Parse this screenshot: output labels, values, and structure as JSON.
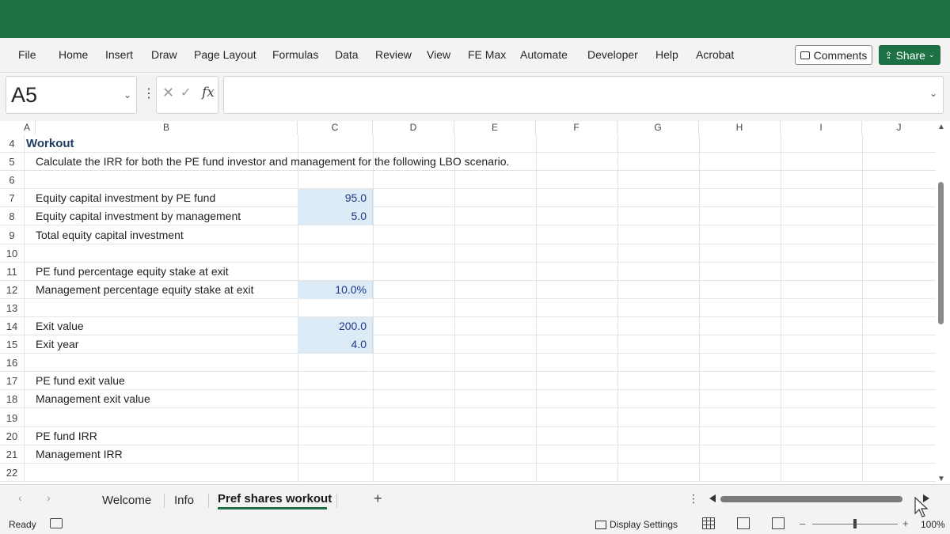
{
  "ribbon": {
    "tabs": [
      "File",
      "Home",
      "Insert",
      "Draw",
      "Page Layout",
      "Formulas",
      "Data",
      "Review",
      "View",
      "FE Max",
      "Automate",
      "Developer",
      "Help",
      "Acrobat"
    ],
    "comments_label": "Comments",
    "share_label": "Share"
  },
  "formula_bar": {
    "name_box": "A5",
    "fx_label": "fx",
    "formula": ""
  },
  "columns": [
    "A",
    "B",
    "C",
    "D",
    "E",
    "F",
    "G",
    "H",
    "I",
    "J"
  ],
  "rows": [
    {
      "num": "4",
      "a": "Workout",
      "b": "",
      "c": ""
    },
    {
      "num": "5",
      "a": "",
      "b": "Calculate the IRR for both the PE fund investor and management for the following LBO scenario.",
      "c": ""
    },
    {
      "num": "6",
      "a": "",
      "b": "",
      "c": ""
    },
    {
      "num": "7",
      "a": "",
      "b": "Equity capital investment by PE fund",
      "c": "95.0"
    },
    {
      "num": "8",
      "a": "",
      "b": "Equity capital investment by management",
      "c": "5.0"
    },
    {
      "num": "9",
      "a": "",
      "b": "Total equity capital investment",
      "c": ""
    },
    {
      "num": "10",
      "a": "",
      "b": "",
      "c": ""
    },
    {
      "num": "11",
      "a": "",
      "b": "PE fund percentage equity stake at exit",
      "c": ""
    },
    {
      "num": "12",
      "a": "",
      "b": "Management percentage equity stake at exit",
      "c": "10.0%"
    },
    {
      "num": "13",
      "a": "",
      "b": "",
      "c": ""
    },
    {
      "num": "14",
      "a": "",
      "b": "Exit value",
      "c": "200.0"
    },
    {
      "num": "15",
      "a": "",
      "b": "Exit year",
      "c": "4.0"
    },
    {
      "num": "16",
      "a": "",
      "b": "",
      "c": ""
    },
    {
      "num": "17",
      "a": "",
      "b": "PE fund exit value",
      "c": ""
    },
    {
      "num": "18",
      "a": "",
      "b": "Management exit value",
      "c": ""
    },
    {
      "num": "19",
      "a": "",
      "b": "",
      "c": ""
    },
    {
      "num": "20",
      "a": "",
      "b": "PE fund IRR",
      "c": ""
    },
    {
      "num": "21",
      "a": "",
      "b": "Management IRR",
      "c": ""
    },
    {
      "num": "22",
      "a": "",
      "b": "",
      "c": ""
    }
  ],
  "sheet_tabs": {
    "tabs": [
      "Welcome",
      "Info",
      "Pref shares workout"
    ],
    "active": "Pref shares workout",
    "add_label": "+"
  },
  "status_bar": {
    "ready": "Ready",
    "display_settings": "Display Settings",
    "zoom": "100%"
  },
  "colors": {
    "brand": "#1e7145",
    "input_fill": "#ddebf7",
    "input_text": "#1f3a8a"
  }
}
